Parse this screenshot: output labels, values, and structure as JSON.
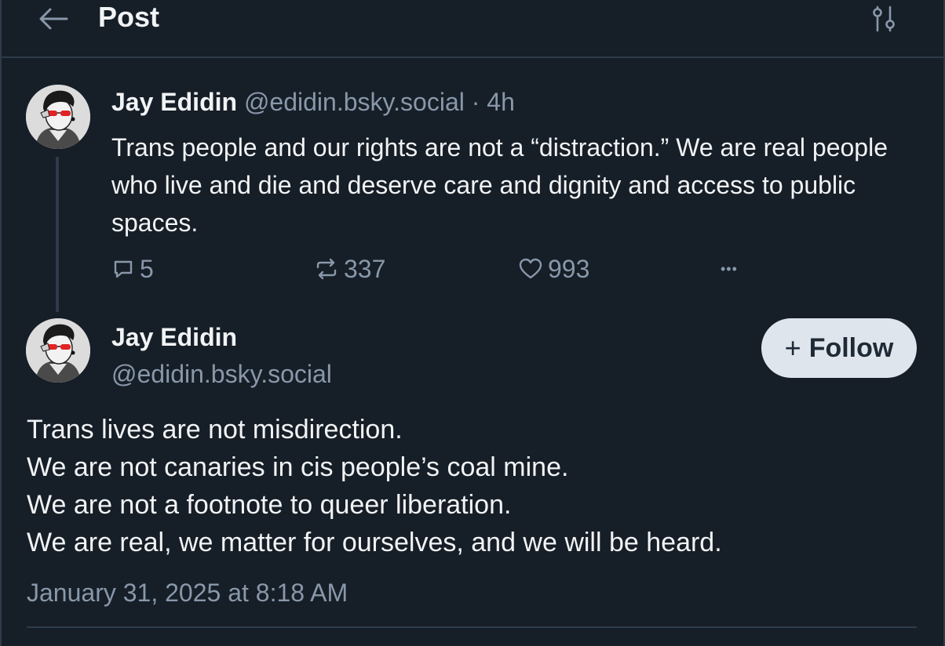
{
  "header": {
    "title": "Post",
    "back_icon": "arrow-left-icon",
    "settings_icon": "sliders-icon"
  },
  "parent_post": {
    "author_name": "Jay Edidin",
    "author_handle": "@edidin.bsky.social",
    "separator": "·",
    "time_ago": "4h",
    "text": "Trans people and our rights are not a “distraction.” We are real people who live and die and deserve care and dignity and access to public spaces.",
    "reply_count": "5",
    "repost_count": "337",
    "like_count": "993",
    "more_label": "•••"
  },
  "main_post": {
    "author_name": "Jay Edidin",
    "author_handle": "@edidin.bsky.social",
    "follow_plus": "+",
    "follow_label": "Follow",
    "lines": [
      "Trans lives are not misdirection.",
      "We are not canaries in cis people’s coal mine.",
      "We are not a footnote to queer liberation.",
      "We are real, we matter for ourselves, and we will be heard."
    ],
    "timestamp": "January 31, 2025 at 8:18 AM"
  },
  "colors": {
    "background": "#161e27",
    "text": "#f1f3f5",
    "muted": "#8898aa",
    "divider": "#2e3b4b",
    "follow_bg": "#dfe5ec"
  }
}
